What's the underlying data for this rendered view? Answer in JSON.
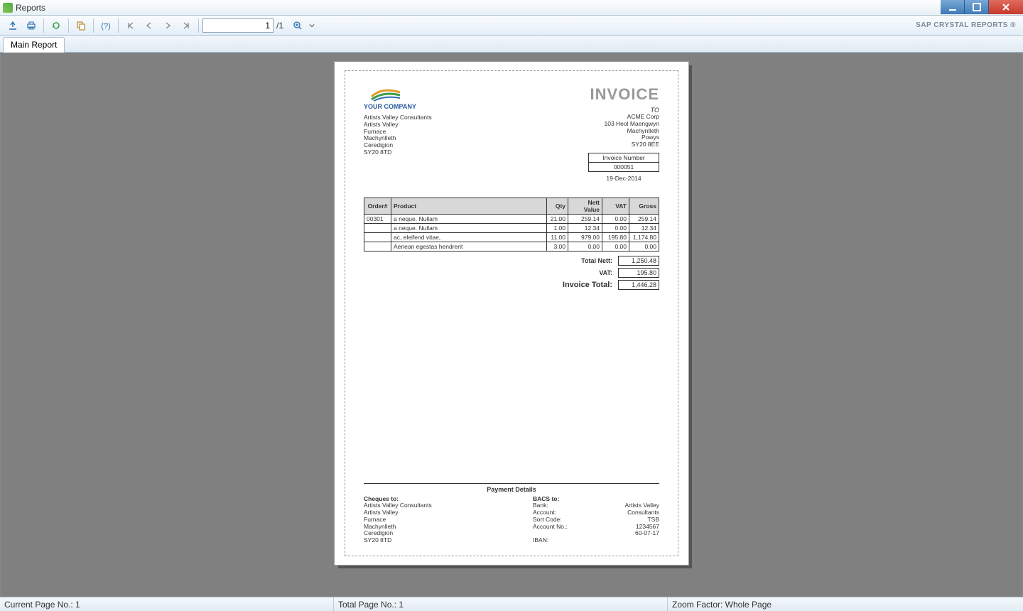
{
  "window": {
    "title": "Reports"
  },
  "toolbar": {
    "page_input_value": "1",
    "page_total": "/1",
    "brand": "SAP CRYSTAL REPORTS ®"
  },
  "tabs": {
    "main": "Main Report"
  },
  "invoice": {
    "logo_company": "YOUR COMPANY",
    "title": "INVOICE",
    "company_address": [
      "Artists Valley Consultants",
      "Artists Valley",
      "Furnace",
      "Machynlleth",
      "Ceredigion",
      "SY20 8TD"
    ],
    "to_label": "TO",
    "client_address": [
      "ACME Corp",
      "103 Heol Maengwyn",
      "Machynlleth",
      "Powys",
      "SY20 8EE"
    ],
    "invoice_number_label": "Invoice Number",
    "invoice_number": "000051",
    "invoice_date": "19-Dec-2014",
    "columns": {
      "order": "Order#",
      "product": "Product",
      "qty": "Qty",
      "nett": "Nett Value",
      "vat": "VAT",
      "gross": "Gross"
    },
    "lines": [
      {
        "order": "00301",
        "product": "a neque. Nullam",
        "qty": "21.00",
        "nett": "259.14",
        "vat": "0.00",
        "gross": "259.14"
      },
      {
        "order": "",
        "product": "a neque. Nullam",
        "qty": "1.00",
        "nett": "12.34",
        "vat": "0.00",
        "gross": "12.34"
      },
      {
        "order": "",
        "product": "ac, eleifend vitae,",
        "qty": "11.00",
        "nett": "979.00",
        "vat": "195.80",
        "gross": "1,174.80"
      },
      {
        "order": "",
        "product": "Aenean egestas hendrerit",
        "qty": "3.00",
        "nett": "0.00",
        "vat": "0.00",
        "gross": "0.00"
      }
    ],
    "totals": {
      "nett_label": "Total Nett:",
      "nett": "1,250.48",
      "vat_label": "VAT:",
      "vat": "195.80",
      "grand_label": "Invoice Total:",
      "grand": "1,446.28"
    },
    "payment": {
      "heading": "Payment Details",
      "cheques_label": "Cheques to:",
      "cheques_address": [
        "Artists Valley Consultants",
        "Artists Valley",
        "Furnace",
        "Machynlleth",
        "Ceredigion",
        "SY20 8TD"
      ],
      "bacs_label": "BACS to:",
      "bank_label": "Bank:",
      "bank": "Artists Valley",
      "account_label": "Account:",
      "account": "Consultants",
      "sortcode_label": "Sort Code:",
      "sortcode": "TSB",
      "accountno_label": "Account No.:",
      "accountno": "1234567",
      "extra_code": "60-07-17",
      "iban_label": "IBAN:"
    }
  },
  "status": {
    "current_page": "Current Page No.: 1",
    "total_page": "Total Page No.: 1",
    "zoom": "Zoom Factor: Whole Page"
  }
}
